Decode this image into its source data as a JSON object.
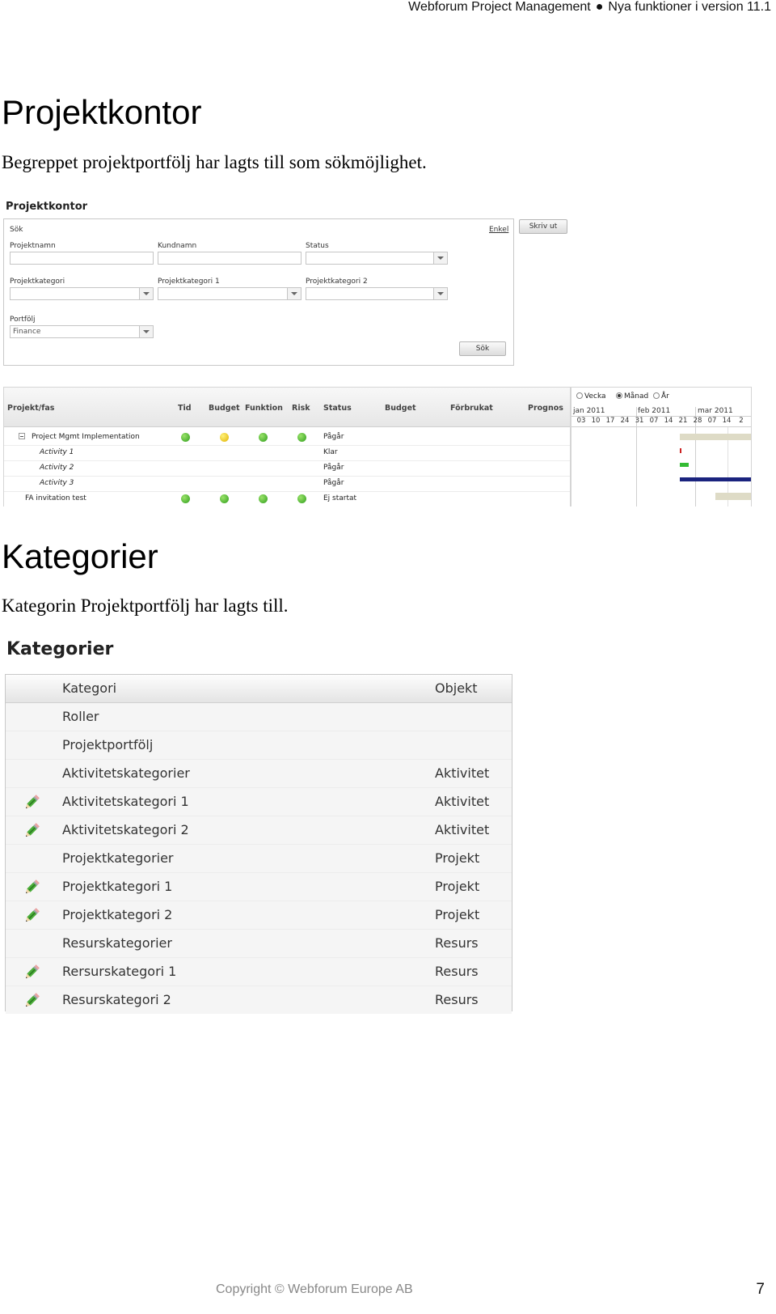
{
  "header": {
    "product": "Webforum Project Management",
    "section": "Nya funktioner i version 11.1"
  },
  "section1": {
    "heading": "Projektkontor",
    "text": "Begreppet projektportfölj har lagts till som sökmöjlighet."
  },
  "projektkontor": {
    "title": "Projektkontor",
    "search": {
      "label": "Sök",
      "enkel": "Enkel",
      "print_button": "Skriv ut",
      "search_button": "Sök",
      "fields": {
        "projektnamn": "Projektnamn",
        "kundnamn": "Kundnamn",
        "status": "Status",
        "projektkategori": "Projektkategori",
        "projektkategori1": "Projektkategori 1",
        "projektkategori2": "Projektkategori 2",
        "portfolj": "Portfölj"
      },
      "portfolj_value": "Finance"
    },
    "grid": {
      "columns": [
        "Projekt/fas",
        "Tid",
        "Budget",
        "Funktion",
        "Risk",
        "Status",
        "Budget",
        "Förbrukat",
        "Prognos"
      ],
      "rows": [
        {
          "name": "Project Mgmt Implementation",
          "indicators": [
            "green",
            "yellow",
            "green",
            "green"
          ],
          "status": "Pågår"
        },
        {
          "name": "Activity 1",
          "indicators": [],
          "status": "Klar"
        },
        {
          "name": "Activity 2",
          "indicators": [],
          "status": "Pågår"
        },
        {
          "name": "Activity 3",
          "indicators": [],
          "status": "Pågår"
        },
        {
          "name": "FA invitation test",
          "indicators": [
            "green",
            "green",
            "green",
            "green"
          ],
          "status": "Ej startat"
        }
      ]
    },
    "gantt": {
      "views": [
        "Vecka",
        "Månad",
        "År"
      ],
      "selected_view": "Månad",
      "months": [
        "jan 2011",
        "feb 2011",
        "mar 2011"
      ],
      "days": [
        "03",
        "10",
        "17",
        "24",
        "31",
        "07",
        "14",
        "21",
        "28",
        "07",
        "14",
        "2"
      ],
      "bar_colors": {
        "phase": "#dedbc6",
        "activity1": "#cc2222",
        "activity2": "#33bb33",
        "activity3": "#1a237e"
      }
    }
  },
  "section2": {
    "heading": "Kategorier",
    "text": "Kategorin Projektportfölj har lagts till."
  },
  "kategorier": {
    "title": "Kategorier",
    "headers": {
      "kategori": "Kategori",
      "objekt": "Objekt"
    },
    "rows": [
      {
        "kategori": "Roller",
        "objekt": "",
        "editable": false
      },
      {
        "kategori": "Projektportfölj",
        "objekt": "",
        "editable": false
      },
      {
        "kategori": "Aktivitetskategorier",
        "objekt": "Aktivitet",
        "editable": false
      },
      {
        "kategori": "Aktivitetskategori 1",
        "objekt": "Aktivitet",
        "editable": true
      },
      {
        "kategori": "Aktivitetskategori 2",
        "objekt": "Aktivitet",
        "editable": true
      },
      {
        "kategori": "Projektkategorier",
        "objekt": "Projekt",
        "editable": false
      },
      {
        "kategori": "Projektkategori 1",
        "objekt": "Projekt",
        "editable": true
      },
      {
        "kategori": "Projektkategori 2",
        "objekt": "Projekt",
        "editable": true
      },
      {
        "kategori": "Resurskategorier",
        "objekt": "Resurs",
        "editable": false
      },
      {
        "kategori": "Rersurskategori 1",
        "objekt": "Resurs",
        "editable": true
      },
      {
        "kategori": "Resurskategori 2",
        "objekt": "Resurs",
        "editable": true
      }
    ]
  },
  "footer": {
    "copyright": "Copyright © Webforum Europe AB",
    "page": "7"
  }
}
